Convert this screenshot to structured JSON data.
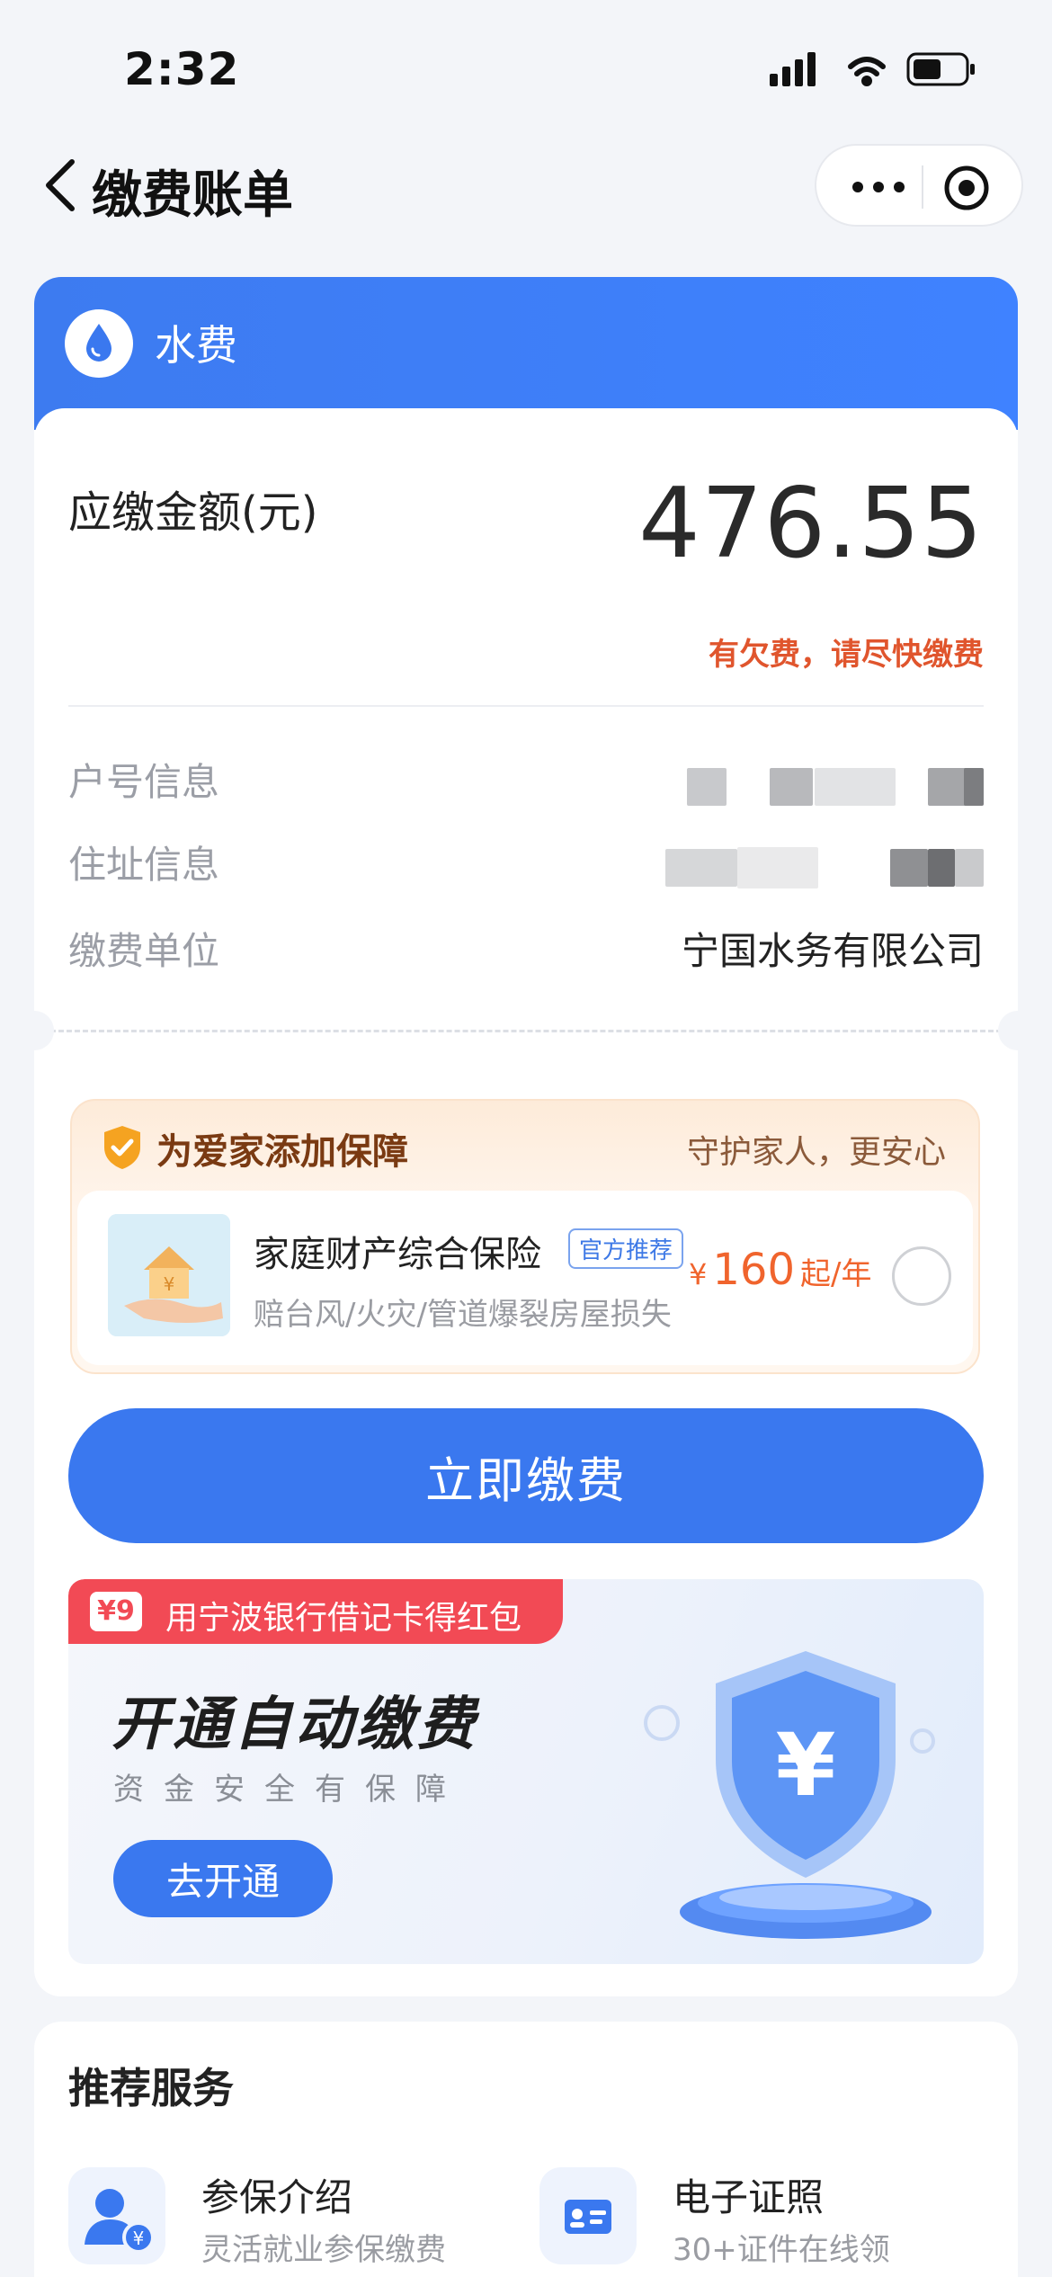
{
  "status_bar": {
    "time": "2:32"
  },
  "nav": {
    "title": "缴费账单"
  },
  "bill": {
    "type_label": "水费",
    "amount_label": "应缴金额(元)",
    "amount": "476.55",
    "warning": "有欠费，请尽快缴费",
    "info": [
      {
        "label": "户号信息",
        "value": ""
      },
      {
        "label": "住址信息",
        "value": ""
      },
      {
        "label": "缴费单位",
        "value": "宁国水务有限公司"
      }
    ]
  },
  "insurance": {
    "header": "为爱家添加保障",
    "slogan": "守护家人，更安心",
    "name": "家庭财产综合保险",
    "tag": "官方推荐",
    "desc": "赔台风/火灾/管道爆裂房屋损失",
    "currency": "¥",
    "price": "160",
    "unit": "起/年"
  },
  "pay_button": "立即缴费",
  "promo": {
    "ribbon_badge": "¥9",
    "ribbon_text": "用宁波银行借记卡得红包",
    "title": "开通自动缴费",
    "subtitle": "资金安全有保障",
    "button": "去开通"
  },
  "services": {
    "title": "推荐服务",
    "items": [
      {
        "name": "参保介绍",
        "desc": "灵活就业参保缴费",
        "icon": "person-yuan-icon"
      },
      {
        "name": "电子证照",
        "desc": "30+证件在线领",
        "icon": "id-card-icon"
      }
    ]
  },
  "colors": {
    "primary": "#3a78ef",
    "warning": "#e0552d",
    "price": "#f0642d"
  }
}
